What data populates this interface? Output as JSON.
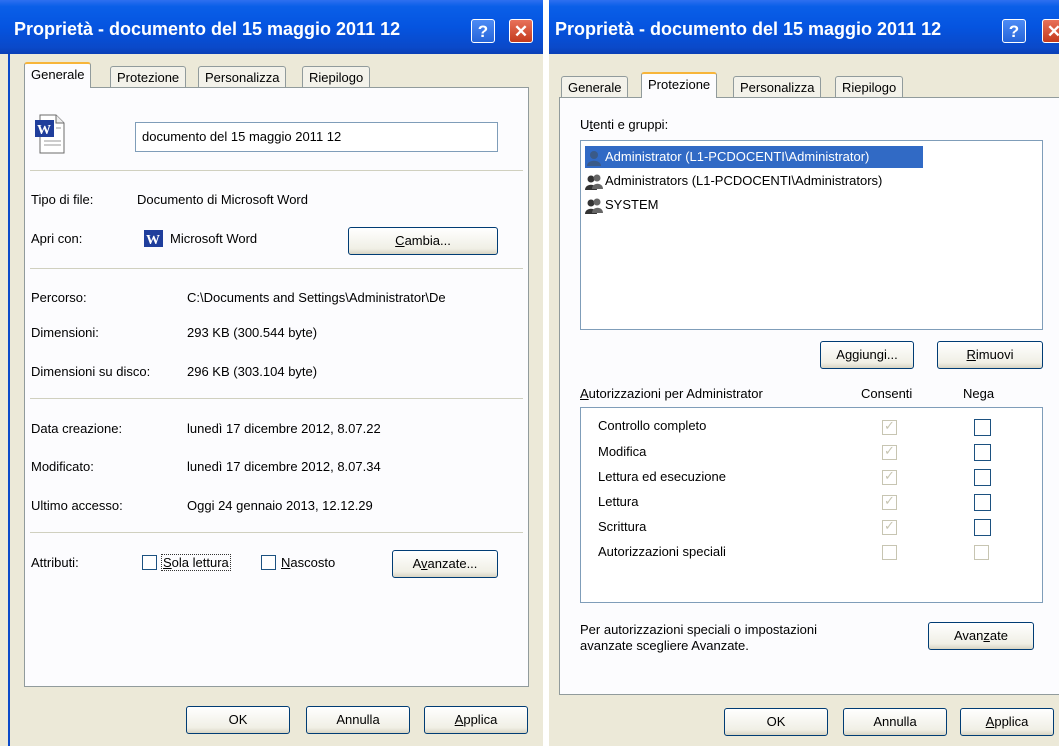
{
  "left": {
    "title": "Proprietà - documento del 15 maggio 2011 12",
    "tabs": [
      "Generale",
      "Protezione",
      "Personalizza",
      "Riepilogo"
    ],
    "filename": "documento del 15 maggio 2011 12",
    "tipo_label": "Tipo di file:",
    "tipo_value": "Documento di Microsoft Word",
    "apri_label": "Apri con:",
    "apri_value": "Microsoft Word",
    "cambia": "Cambia...",
    "percorso_label": "Percorso:",
    "percorso_value": "C:\\Documents and Settings\\Administrator\\De",
    "dim_label": "Dimensioni:",
    "dim_value": "293 KB (300.544 byte)",
    "dimdisco_label": "Dimensioni su disco:",
    "dimdisco_value": "296 KB (303.104 byte)",
    "creazione_label": "Data creazione:",
    "creazione_value": "lunedì 17 dicembre 2012, 8.07.22",
    "modificato_label": "Modificato:",
    "modificato_value": "lunedì 17 dicembre 2012, 8.07.34",
    "accesso_label": "Ultimo accesso:",
    "accesso_value": "Oggi 24 gennaio 2013, 12.12.29",
    "attributi_label": "Attributi:",
    "sola_lettura": "Sola lettura",
    "nascosto": "Nascosto",
    "avanzate": "Avanzate...",
    "ok": "OK",
    "annulla": "Annulla",
    "applica": "Applica"
  },
  "right": {
    "title": "Proprietà - documento del 15 maggio 2011 12",
    "tabs": [
      "Generale",
      "Protezione",
      "Personalizza",
      "Riepilogo"
    ],
    "utenti_label": "Utenti e gruppi:",
    "users": [
      "Administrator (L1-PCDOCENTI\\Administrator)",
      "Administrators (L1-PCDOCENTI\\Administrators)",
      "SYSTEM"
    ],
    "aggiungi": "Aggiungi...",
    "rimuovi": "Rimuovi",
    "perm_header": "Autorizzazioni per Administrator",
    "consenti": "Consenti",
    "nega": "Nega",
    "permissions": [
      {
        "name": "Controllo completo",
        "allow": true,
        "deny": false
      },
      {
        "name": "Modifica",
        "allow": true,
        "deny": false
      },
      {
        "name": "Lettura ed esecuzione",
        "allow": true,
        "deny": false
      },
      {
        "name": "Lettura",
        "allow": true,
        "deny": false
      },
      {
        "name": "Scrittura",
        "allow": true,
        "deny": false
      },
      {
        "name": "Autorizzazioni speciali",
        "allow": false,
        "deny": false
      }
    ],
    "info_line1": "Per autorizzazioni speciali o impostazioni",
    "info_line2": "avanzate scegliere Avanzate.",
    "avanzate": "Avanzate",
    "ok": "OK",
    "annulla": "Annulla",
    "applica": "Applica"
  },
  "colors": {
    "titlebar": "#0554e0",
    "dialog_bg": "#ECE9D8",
    "selection": "#316ac5",
    "active_tab_accent": "#f7b53a"
  }
}
